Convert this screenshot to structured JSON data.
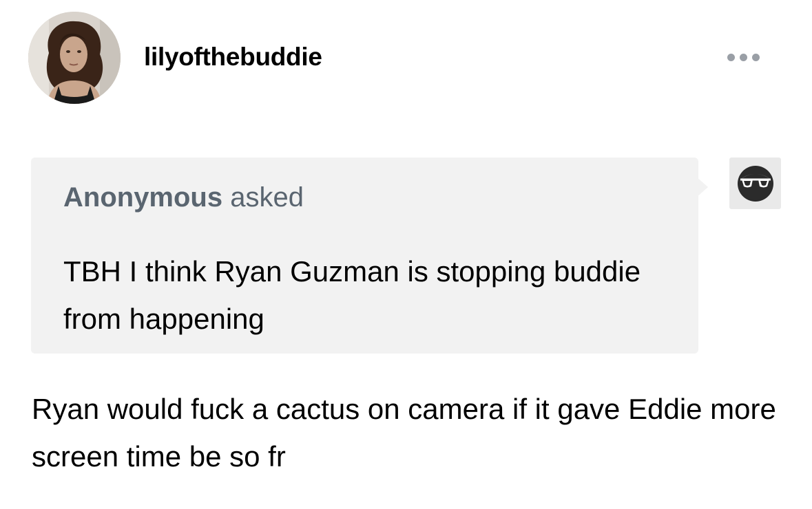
{
  "post": {
    "username": "lilyofthebuddie",
    "avatar_icon": "user-avatar-photo",
    "more_icon": "ellipsis-icon"
  },
  "ask": {
    "asker": "Anonymous",
    "verb": "asked",
    "question": "TBH I think Ryan Guzman is stopping buddie from happening",
    "anon_avatar_icon": "anonymous-sunglasses-icon"
  },
  "answer": {
    "text": "Ryan would fuck a cactus on camera if it gave Eddie more screen time be so fr"
  },
  "colors": {
    "bubble_bg": "#f2f2f2",
    "asker_text": "#5a6570",
    "dots": "#9a9fa6"
  }
}
